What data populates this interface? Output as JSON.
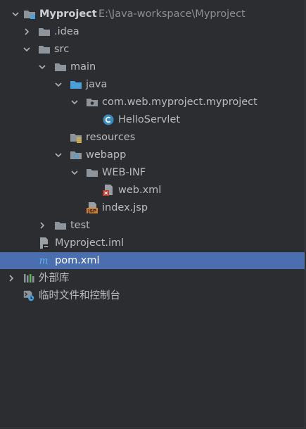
{
  "tree": {
    "root_name": "Myproject",
    "root_path": "E:\\Java-workspace\\Myproject",
    "idea": ".idea",
    "src": "src",
    "main": "main",
    "java": "java",
    "package": "com.web.myproject.myproject",
    "servlet": "HelloServlet",
    "resources": "resources",
    "webapp": "webapp",
    "webinf": "WEB-INF",
    "webxml": "web.xml",
    "indexjsp": "index.jsp",
    "test": "test",
    "iml": "Myproject.iml",
    "pom": "pom.xml",
    "external_libraries": "外部库",
    "scratches": "临时文件和控制台"
  },
  "colors": {
    "background": "#2b2d30",
    "selection": "#4b6eaf",
    "folder": "#8e949b",
    "source_folder": "#4aa0d8",
    "class_icon": "#3c8dbd",
    "jsp_icon": "#d47f2e"
  }
}
